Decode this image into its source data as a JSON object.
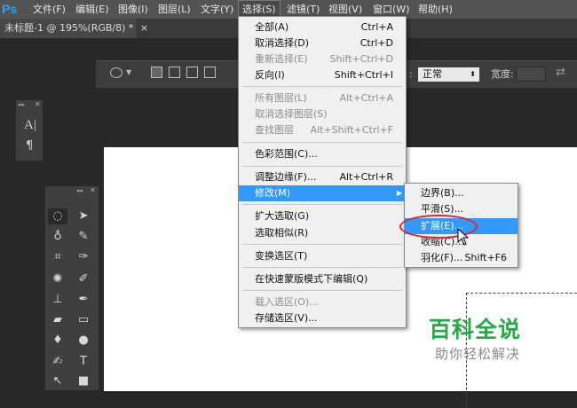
{
  "app": {
    "logo": "Ps"
  },
  "menubar": {
    "items": [
      {
        "label": "文件(F)"
      },
      {
        "label": "编辑(E)"
      },
      {
        "label": "图像(I)"
      },
      {
        "label": "图层(L)"
      },
      {
        "label": "文字(Y)"
      },
      {
        "label": "选择(S)"
      },
      {
        "label": "滤镜(T)"
      },
      {
        "label": "视图(V)"
      },
      {
        "label": "窗口(W)"
      },
      {
        "label": "帮助(H)"
      }
    ]
  },
  "document_tab": {
    "title": "未标题-1 @ 195%(RGB/8) *",
    "close": "×"
  },
  "options_bar": {
    "style_value": "正常",
    "width_label": "宽度:",
    "width_value": ""
  },
  "select_menu": {
    "items": [
      {
        "label": "全部(A)",
        "shortcut": "Ctrl+A",
        "enabled": true
      },
      {
        "label": "取消选择(D)",
        "shortcut": "Ctrl+D",
        "enabled": true
      },
      {
        "label": "重新选择(E)",
        "shortcut": "Shift+Ctrl+D",
        "enabled": false
      },
      {
        "label": "反向(I)",
        "shortcut": "Shift+Ctrl+I",
        "enabled": true
      },
      {
        "label": "所有图层(L)",
        "shortcut": "Alt+Ctrl+A",
        "enabled": false
      },
      {
        "label": "取消选择图层(S)",
        "shortcut": "",
        "enabled": false
      },
      {
        "label": "查找图层",
        "shortcut": "Alt+Shift+Ctrl+F",
        "enabled": false
      },
      {
        "label": "色彩范围(C)...",
        "shortcut": "",
        "enabled": true
      },
      {
        "label": "调整边缘(F)...",
        "shortcut": "Alt+Ctrl+R",
        "enabled": true
      },
      {
        "label": "修改(M)",
        "shortcut": "",
        "enabled": true,
        "highlighted": true
      },
      {
        "label": "扩大选取(G)",
        "shortcut": "",
        "enabled": true
      },
      {
        "label": "选取相似(R)",
        "shortcut": "",
        "enabled": true
      },
      {
        "label": "变换选区(T)",
        "shortcut": "",
        "enabled": true
      },
      {
        "label": "在快速蒙版模式下编辑(Q)",
        "shortcut": "",
        "enabled": true
      },
      {
        "label": "载入选区(O)...",
        "shortcut": "",
        "enabled": false
      },
      {
        "label": "存储选区(V)...",
        "shortcut": "",
        "enabled": true
      }
    ]
  },
  "modify_submenu": {
    "items": [
      {
        "label": "边界(B)...",
        "shortcut": ""
      },
      {
        "label": "平滑(S)...",
        "shortcut": ""
      },
      {
        "label": "扩展(E)...",
        "shortcut": "",
        "highlighted": true
      },
      {
        "label": "收缩(C)...",
        "shortcut": ""
      },
      {
        "label": "羽化(F)...",
        "shortcut": "Shift+F6"
      }
    ]
  },
  "watermark": {
    "title": "百科全说",
    "subtitle": "助你轻松解决"
  },
  "colors": {
    "menu_highlight": "#3399ff",
    "ps_blue": "#2fa2f6",
    "annotation_red": "#d42a2a",
    "watermark_green": "#28a745"
  }
}
